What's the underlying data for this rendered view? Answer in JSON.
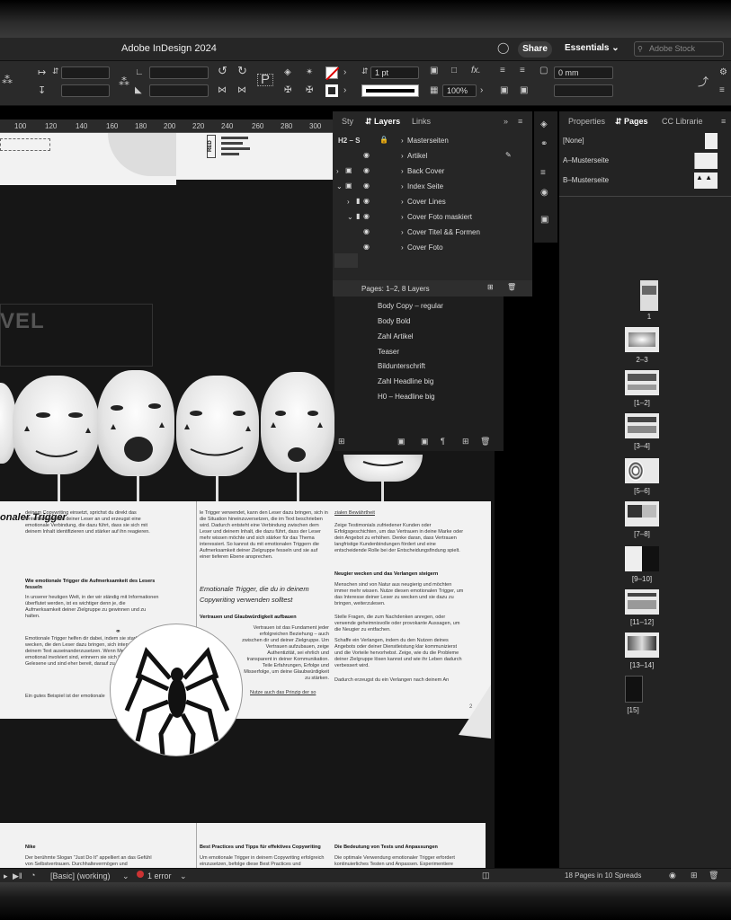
{
  "app": {
    "title": "Adobe InDesign 2024",
    "share_label": "Share",
    "workspace_label": "Essentials",
    "stock_placeholder": "Adobe Stock"
  },
  "control": {
    "stroke_weight": "1 pt",
    "zoom_percent": "100%",
    "offset_value": "0 mm"
  },
  "ruler": {
    "ticks": [
      "100",
      "120",
      "140",
      "160",
      "180",
      "200",
      "220",
      "240",
      "260",
      "280",
      "300"
    ]
  },
  "left_panels": {
    "tabs": [
      "Sty",
      "Layers",
      "Links"
    ],
    "active_tab": "Layers"
  },
  "layers": {
    "rows": [
      {
        "name": "Masterseiten",
        "prefix": "H2 – S"
      },
      {
        "name": "Artikel"
      },
      {
        "name": "Back Cover"
      },
      {
        "name": "Index Seite"
      },
      {
        "name": "Cover Lines"
      },
      {
        "name": "Cover Foto maskiert"
      },
      {
        "name": "Cover Titel && Formen"
      },
      {
        "name": "Cover Foto"
      }
    ],
    "footer": "Pages: 1–2, 8 Layers"
  },
  "paragraph_styles": [
    "Body Copy – regular",
    "Body Bold",
    "Zahl Artikel",
    "Teaser",
    "Bildunterschrift",
    "Zahl Headline big",
    "H0 – Headline big"
  ],
  "right_panels": {
    "tabs": [
      "Properties",
      "Pages",
      "CC Librarie"
    ],
    "active_tab": "Pages",
    "masters": [
      "[None]",
      "A–Musterseite",
      "B–Musterseite"
    ],
    "page_labels": [
      "1",
      "2–3",
      "[1–2]",
      "[3–4]",
      "[5–6]",
      "[7–8]",
      "[9–10]",
      "[11–12]",
      "[13–14]",
      "[15]"
    ],
    "footer": "18 Pages in 10 Spreads"
  },
  "document": {
    "headline": "onaler Trigger",
    "vel_text": "VEL",
    "red_label": "RED",
    "italic_heading": "Emotionale Trigger, die du in deinem Copywriting verwenden solltest",
    "sub_heading_1": "Wie emotionale Trigger die Aufmerksamkeit des Lesers fesseln",
    "sub_heading_2": "Vertrauen und Glaubwürdigkeit aufbauen",
    "sub_heading_3": "Neugier wecken und das Verlangen steigern",
    "page_number": "2",
    "col1_text": "deinem Copywriting einsetzt, sprichst du direkt das Unterbewusstsein deiner Leser an und erzeugst eine emotionale Verbindung, die dazu führt, dass sie sich mit deinem Inhalt identifizieren und stärker auf ihn reagieren.",
    "col1_text_b": "In unserer heutigen Welt, in der wir ständig mit Informationen überflutet werden, ist es wichtiger denn je, die Aufmerksamkeit deiner Zielgruppe zu gewinnen und zu halten.",
    "col1_text_c": "Emotionale Trigger helfen dir dabei, indem sie starke Gefühle wecken, die den Leser dazu bringen, sich intensiver mit deinem Text auseinanderzusetzen. Wenn Menschen emotional involviert sind, erinnern sie sich besser an das Gelesene und sind eher bereit, darauf zu reagieren.",
    "col1_text_d": "Ein gutes Beispiel ist der emotionale",
    "col2_text": "le Trigger verwendet, kann den Leser dazu bringen, sich in die Situation hineinzuversetzen, die im Text beschrieben wird. Dadurch entsteht eine Verbindung zwischen dem Leser und deinem Inhalt, die dazu führt, dass der Leser mehr wissen möchte und sich stärker für das Thema interessiert. So kannst du mit emotionalen Triggern die Aufmerksamkeit deiner Zielgruppe fesseln und sie auf einer tieferen Ebene ansprechen.",
    "col2_text_b": "Vertrauen ist das Fundament jeder erfolgreichen Beziehung – auch zwischen dir und deiner Zielgruppe. Um Vertrauen aufzubauen, zeige Authentizität, sei ehrlich und transparent in deiner Kommunikation. Teile Erfahrungen, Erfolge und Misserfolge, um deine Glaubwürdigkeit zu stärken.",
    "col2_text_c": "Nutze auch das Prinzip der so",
    "col3_text": "zialen Bewährtheit",
    "col3_text_b": "Zeige Testimonials zufriedener Kunden oder Erfolgsgeschichten, um das Vertrauen in deine Marke oder dein Angebot zu erhöhen. Denke daran, dass Vertrauen langfristige Kundenbindungen fördert und eine entscheidende Rolle bei der Entscheidungsfindung spielt.",
    "col3_text_c": "Menschen sind von Natur aus neugierig und möchten immer mehr wissen. Nutze diesen emotionalen Trigger, um das Interesse deiner Leser zu wecken und sie dazu zu bringen, weiterzulesen.",
    "col3_text_d": "Stelle Fragen, die zum Nachdenken anregen, oder verwende geheimnisvolle oder provokante Aussagen, um die Neugier zu entfachen.",
    "col3_text_e": "Schaffe ein Verlangen, indem du den Nutzen deines Angebots oder deiner Dienstleistung klar kommunizierst und die Vorteile hervorhebst. Zeige, wie du die Probleme deiner Zielgruppe lösen kannst und wie ihr Leben dadurch verbessert wird.",
    "col3_text_f": "Dadurch erzeugst du ein Verlangen nach deinem An",
    "lower_heading_1": "Nike",
    "lower_text_1": "Der berühmte Slogan \"Just Do It\" appelliert an das Gefühl von Selbstvertrauen. Durchhaltevermögen und",
    "lower_heading_2": "Best Practices und Tipps für effektives Copywriting",
    "lower_text_2": "Um emotionale Trigger in deinem Copywriting erfolgreich einzusetzen, befolge diese Best Practices und",
    "lower_heading_3": "Die Bedeutung von Tests und Anpassungen",
    "lower_text_3": "Die optimale Verwendung emotionaler Trigger erfordert kontinuierliches Testen und Anpassen. Experimentiere"
  },
  "status": {
    "preflight": "[Basic] (working)",
    "errors": "1 error"
  },
  "colors": {
    "panel_bg": "#262626",
    "pasteboard": "#161616",
    "page": "#f2f2f2"
  }
}
